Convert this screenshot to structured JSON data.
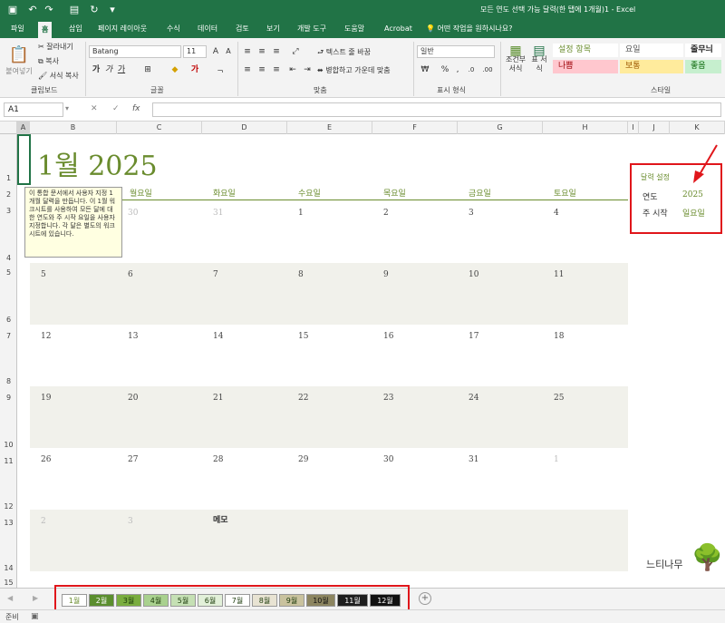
{
  "window": {
    "title": "모든 연도 선택 가능 달력(한 탭에 1개월)1 - Excel"
  },
  "quick_access": {
    "icons": [
      "save-icon",
      "undo-icon",
      "redo-icon",
      "form-icon",
      "refresh-icon",
      "customize-icon"
    ]
  },
  "ribbon_tabs": [
    "파일",
    "홈",
    "삽입",
    "페이지 레이아웃",
    "수식",
    "데이터",
    "검토",
    "보기",
    "개발 도구",
    "도움말",
    "Acrobat"
  ],
  "tell_me": "어떤 작업을 원하시나요?",
  "ribbon": {
    "clipboard": {
      "paste": "붙여넣기",
      "cut": "잘라내기",
      "copy": "복사",
      "format_painter": "서식 복사",
      "label": "클립보드"
    },
    "font": {
      "name": "Batang",
      "size": "11",
      "label": "글꼴",
      "bold": "가",
      "italic": "가",
      "underline": "가"
    },
    "align": {
      "wrap": "텍스트 줄 바꿈",
      "merge": "병합하고 가운데 맞춤",
      "label": "맞춤"
    },
    "number": {
      "format": "일반",
      "label": "표시 형식"
    },
    "styles": {
      "conditional": "조건부 서식",
      "table": "표 서식",
      "cells": [
        {
          "text": "설정 항목",
          "bg": "#ffffff",
          "fg": "#6a8c2e"
        },
        {
          "text": "요일",
          "bg": "#ffffff",
          "fg": "#555555"
        },
        {
          "text": "줄무늬",
          "bg": "#ffffff",
          "fg": "#222222"
        },
        {
          "text": "나쁨",
          "bg": "#ffc7ce",
          "fg": "#9c0006"
        },
        {
          "text": "보통",
          "bg": "#ffeb9c",
          "fg": "#9c5700"
        },
        {
          "text": "좋음",
          "bg": "#c6efce",
          "fg": "#006100"
        }
      ],
      "label": "스타일"
    }
  },
  "formula_bar": {
    "cell_ref": "A1",
    "fx": "fx",
    "cancel": "✕",
    "enter": "✓"
  },
  "columns": [
    "A",
    "B",
    "C",
    "D",
    "E",
    "F",
    "G",
    "H",
    "I",
    "J",
    "K"
  ],
  "rows": [
    "1",
    "2",
    "3",
    "4",
    "5",
    "6",
    "7",
    "8",
    "9",
    "10",
    "11",
    "12",
    "13",
    "14",
    "15"
  ],
  "calendar": {
    "title": "1월 2025",
    "weekdays": [
      "월요일",
      "화요일",
      "수요일",
      "목요일",
      "금요일",
      "토요일"
    ],
    "weeks": [
      [
        {
          "v": "30",
          "dim": true
        },
        {
          "v": "31",
          "dim": true
        },
        {
          "v": "1"
        },
        {
          "v": "2"
        },
        {
          "v": "3"
        },
        {
          "v": "4"
        }
      ],
      [
        {
          "v": "5"
        },
        {
          "v": "6"
        },
        {
          "v": "7"
        },
        {
          "v": "8"
        },
        {
          "v": "9"
        },
        {
          "v": "10"
        },
        {
          "v": "11"
        }
      ],
      [
        {
          "v": "12"
        },
        {
          "v": "13"
        },
        {
          "v": "14"
        },
        {
          "v": "15"
        },
        {
          "v": "16"
        },
        {
          "v": "17"
        },
        {
          "v": "18"
        }
      ],
      [
        {
          "v": "19"
        },
        {
          "v": "20"
        },
        {
          "v": "21"
        },
        {
          "v": "22"
        },
        {
          "v": "23"
        },
        {
          "v": "24"
        },
        {
          "v": "25"
        }
      ],
      [
        {
          "v": "26"
        },
        {
          "v": "27"
        },
        {
          "v": "28"
        },
        {
          "v": "29"
        },
        {
          "v": "30"
        },
        {
          "v": "31"
        },
        {
          "v": "1",
          "dim": true
        }
      ],
      [
        {
          "v": "2",
          "dim": true
        },
        {
          "v": "3",
          "dim": true
        }
      ]
    ],
    "memo_label": "메모",
    "tooltip": "이 통합 문서에서 사용자 지정 1개월 달력을 만듭니다. 이 1월 워크시트를 사용하여 모든 달에 대한 연도와 주 시작 요일을 사용자 지정합니다. 각 달은 별도의 워크시트에 있습니다."
  },
  "settings": {
    "heading": "달력 설정",
    "year_label": "연도",
    "year_value": "2025",
    "week_start_label": "주 시작",
    "week_start_value": "일요일"
  },
  "sheet_tabs": [
    {
      "label": "1월",
      "bg": "#ffffff",
      "fg": "#6a8c2e"
    },
    {
      "label": "2월",
      "bg": "#5b8e2e",
      "fg": "#ffffff"
    },
    {
      "label": "3월",
      "bg": "#7aad3f",
      "fg": "#1c3b0b"
    },
    {
      "label": "4월",
      "bg": "#a9d18e",
      "fg": "#1c3b0b"
    },
    {
      "label": "5월",
      "bg": "#c5e0b4",
      "fg": "#1c3b0b"
    },
    {
      "label": "6월",
      "bg": "#e2f0d9",
      "fg": "#1c3b0b"
    },
    {
      "label": "7월",
      "bg": "#ffffff",
      "fg": "#1c3b0b"
    },
    {
      "label": "8월",
      "bg": "#e8e3d3",
      "fg": "#1c3b0b"
    },
    {
      "label": "9월",
      "bg": "#c9c29e",
      "fg": "#1c3b0b"
    },
    {
      "label": "10월",
      "bg": "#8c8560",
      "fg": "#111111"
    },
    {
      "label": "11월",
      "bg": "#1e1e1e",
      "fg": "#ffffff"
    },
    {
      "label": "12월",
      "bg": "#111111",
      "fg": "#ffffff"
    }
  ],
  "status": {
    "ready": "준비"
  },
  "watermark": "느티나무"
}
